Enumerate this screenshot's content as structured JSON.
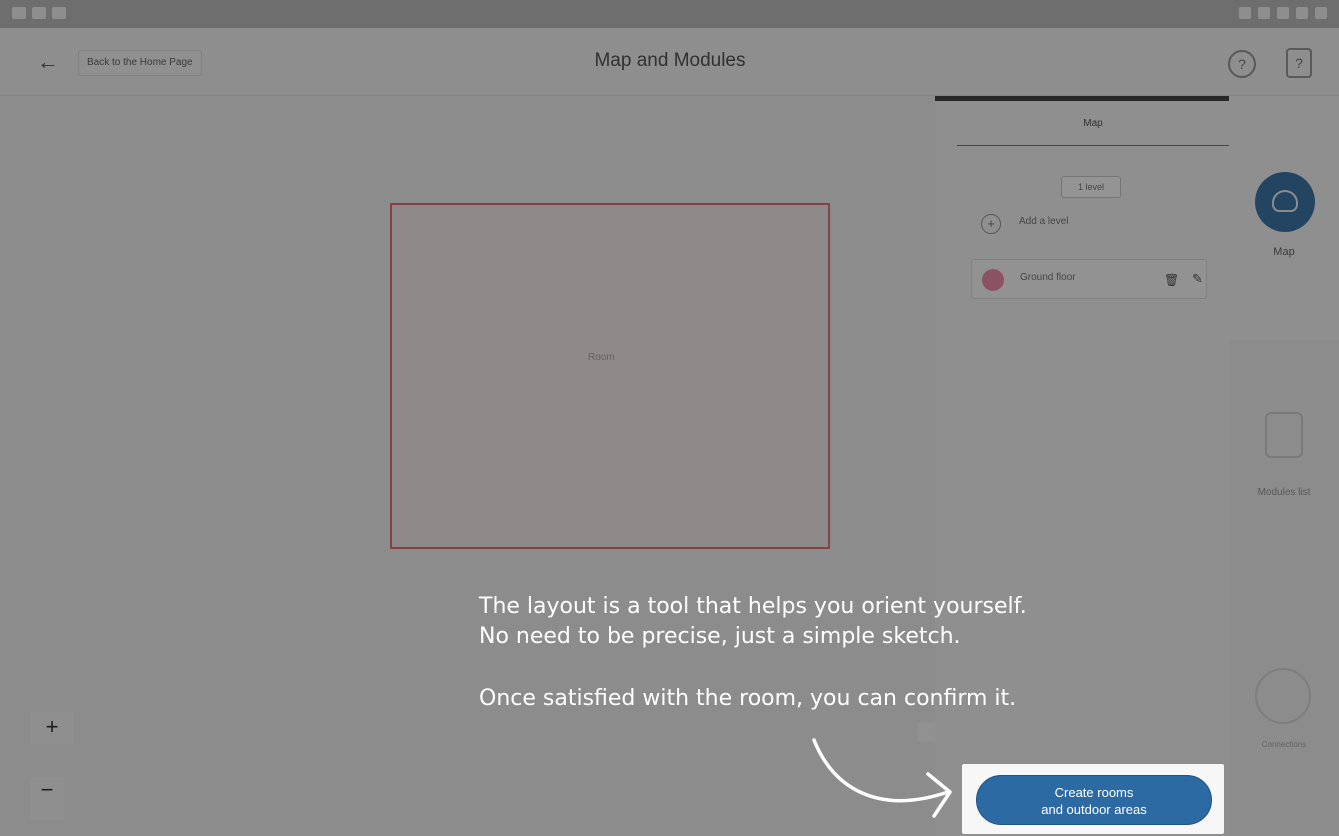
{
  "app": {
    "title": "Map and Modules",
    "back_label": "Back to the Home Page"
  },
  "panel": {
    "tab_map": "Map",
    "level_chip": "1 level",
    "add_level": "Add a level",
    "ground_floor": "Ground floor"
  },
  "canvas": {
    "room_label": "Room\n"
  },
  "rail": {
    "map_label": "Map",
    "modules_label": "Modules list",
    "connections_label": "Connections"
  },
  "tutorial": {
    "line1": "The layout is a tool that helps you orient yourself.",
    "line2": "No need to be precise, just a simple sketch.",
    "line3": "Once satisfied with the room, you can confirm it."
  },
  "cta": {
    "line1": "Create rooms",
    "line2": "and outdoor areas"
  },
  "colors": {
    "accent": "#2b6aa3",
    "room_border": "#e57373",
    "ground_dot": "#f08eaa"
  }
}
